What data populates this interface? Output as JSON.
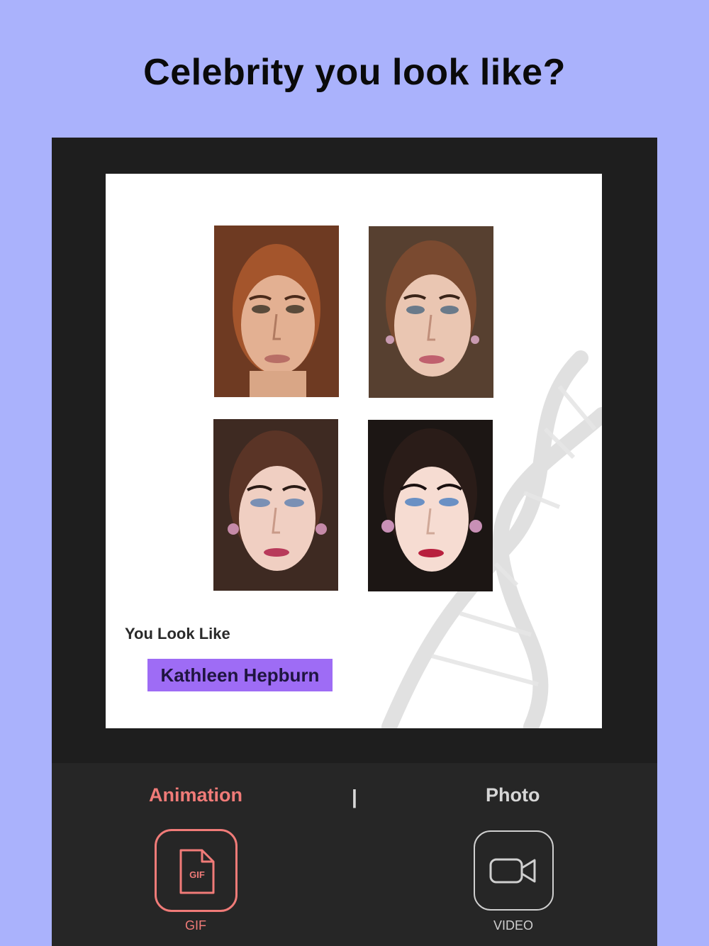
{
  "headline": "Celebrity you look like?",
  "result": {
    "label": "You Look Like",
    "name": "Kathleen Hepburn"
  },
  "photos": [
    {
      "name": "user-photo"
    },
    {
      "name": "morph-step-1"
    },
    {
      "name": "morph-step-2"
    },
    {
      "name": "celebrity-photo"
    }
  ],
  "tabs": {
    "animation": "Animation",
    "separator": "|",
    "photo": "Photo",
    "active": "Animation"
  },
  "options": {
    "gif": {
      "label": "GIF",
      "icon_text": "GIF",
      "icon": "gif-file-icon"
    },
    "video": {
      "label": "VIDEO",
      "icon": "video-camera-icon"
    }
  },
  "colors": {
    "background": "#aab2fc",
    "accent": "#f07b78",
    "highlight": "#9e6cf5",
    "panel": "#1e1e1e"
  }
}
